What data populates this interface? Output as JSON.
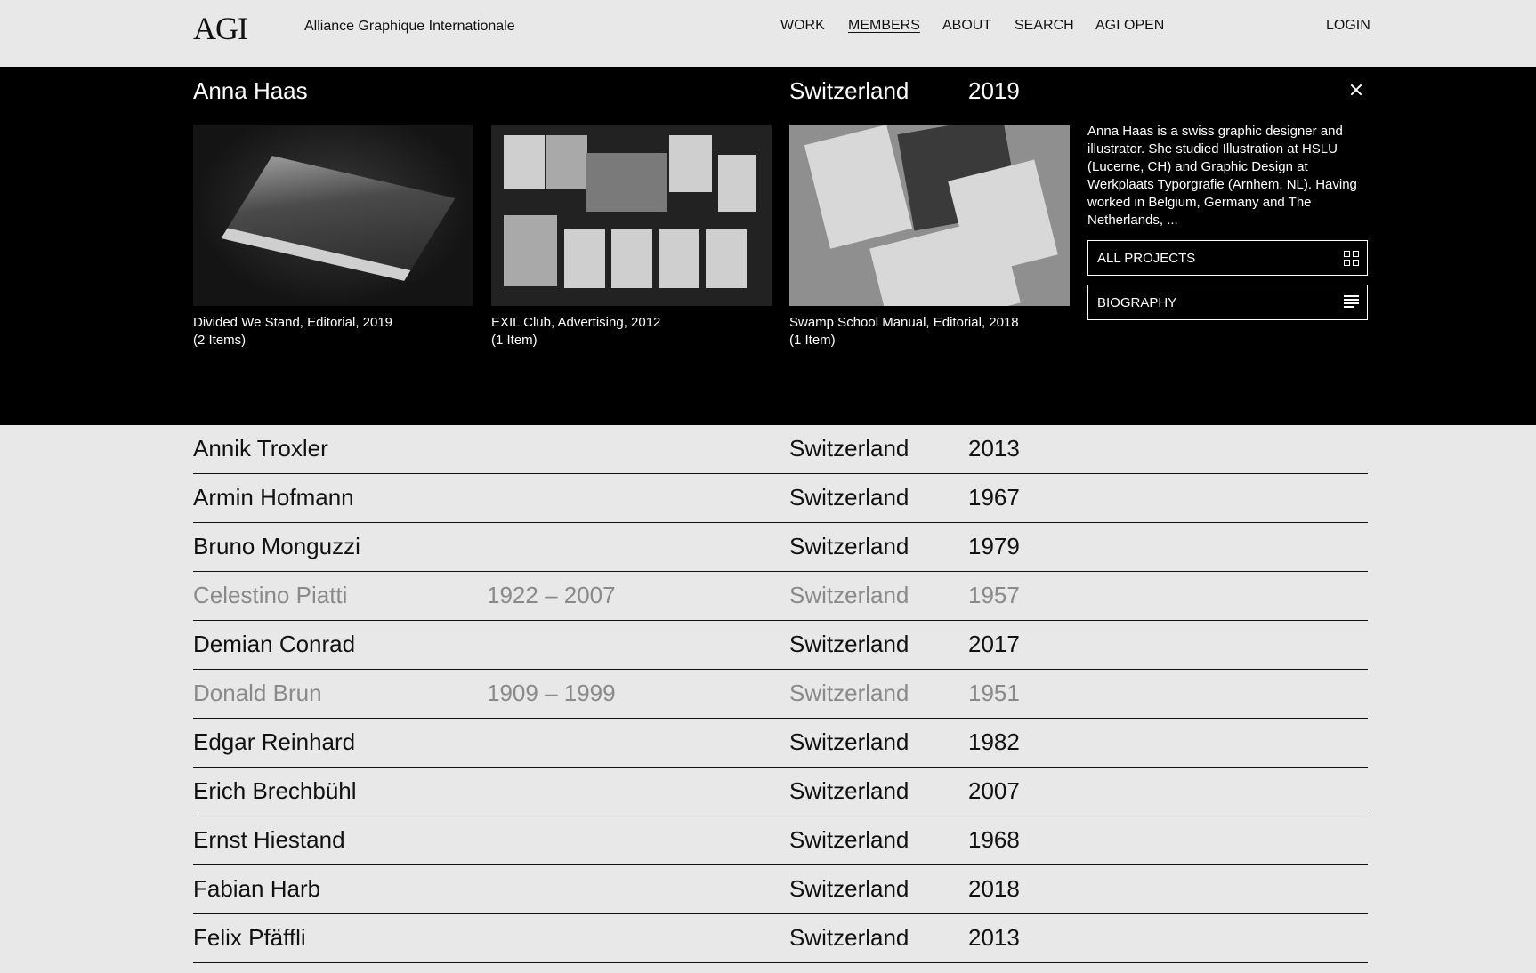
{
  "header": {
    "logo": "AGI",
    "org_name": "Alliance Graphique Internationale",
    "nav": [
      {
        "label": "WORK",
        "active": false
      },
      {
        "label": "MEMBERS",
        "active": true
      },
      {
        "label": "ABOUT",
        "active": false
      },
      {
        "label": "SEARCH",
        "active": false
      },
      {
        "label": "AGI OPEN",
        "active": false
      }
    ],
    "login": "LOGIN"
  },
  "featured": {
    "name": "Anna Haas",
    "country": "Switzerland",
    "year": "2019",
    "projects": [
      {
        "title": "Divided We Stand, Editorial, 2019",
        "count": "(2 Items)"
      },
      {
        "title": "EXIL Club, Advertising, 2012",
        "count": "(1 Item)"
      },
      {
        "title": "Swamp School Manual, Editorial, 2018",
        "count": "(1 Item)"
      }
    ],
    "bio": "Anna Haas is a swiss graphic designer and illustrator. She studied Illustration at HSLU (Lucerne, CH) and Graphic Design at Werkplaats Typorgrafie (Arnhem, NL). Having worked in Belgium, Germany and The Netherlands, ...",
    "buttons": {
      "all_projects": "ALL PROJECTS",
      "biography": "BIOGRAPHY"
    }
  },
  "members": [
    {
      "name": "Annik Troxler",
      "dates": "",
      "country": "Switzerland",
      "year": "2013",
      "deceased": false
    },
    {
      "name": "Armin Hofmann",
      "dates": "",
      "country": "Switzerland",
      "year": "1967",
      "deceased": false
    },
    {
      "name": "Bruno Monguzzi",
      "dates": "",
      "country": "Switzerland",
      "year": "1979",
      "deceased": false
    },
    {
      "name": "Celestino Piatti",
      "dates": "1922 – 2007",
      "country": "Switzerland",
      "year": "1957",
      "deceased": true
    },
    {
      "name": "Demian Conrad",
      "dates": "",
      "country": "Switzerland",
      "year": "2017",
      "deceased": false
    },
    {
      "name": "Donald Brun",
      "dates": "1909 – 1999",
      "country": "Switzerland",
      "year": "1951",
      "deceased": true
    },
    {
      "name": "Edgar Reinhard",
      "dates": "",
      "country": "Switzerland",
      "year": "1982",
      "deceased": false
    },
    {
      "name": "Erich Brechbühl",
      "dates": "",
      "country": "Switzerland",
      "year": "2007",
      "deceased": false
    },
    {
      "name": "Ernst Hiestand",
      "dates": "",
      "country": "Switzerland",
      "year": "1968",
      "deceased": false
    },
    {
      "name": "Fabian Harb",
      "dates": "",
      "country": "Switzerland",
      "year": "2018",
      "deceased": false
    },
    {
      "name": "Felix Pfäffli",
      "dates": "",
      "country": "Switzerland",
      "year": "2013",
      "deceased": false
    }
  ]
}
